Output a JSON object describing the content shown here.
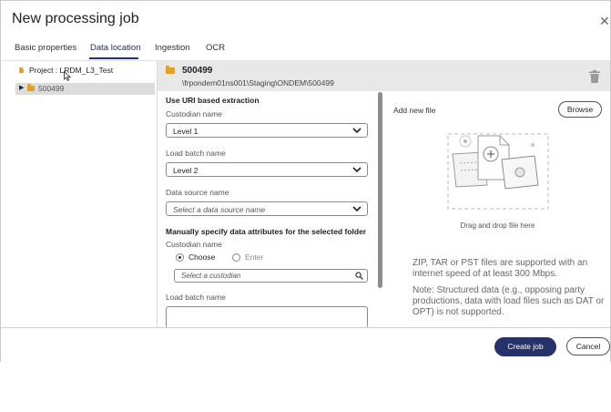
{
  "dialog": {
    "title": "New processing job"
  },
  "tabs": [
    "Basic properties",
    "Data location",
    "Ingestion",
    "OCR"
  ],
  "active_tab": "Data location",
  "tree": {
    "project_label": "Project : LRDM_L3_Test",
    "items": [
      {
        "label": "500499",
        "selected": true
      }
    ]
  },
  "folder": {
    "name": "500499",
    "path": "\\frpondem01ns001\\Staging\\ONDEM\\500499"
  },
  "form": {
    "uri_heading": "Use URI based extraction",
    "custodian_label": "Custodian name",
    "custodian_value": "Level 1",
    "load_batch_label": "Load batch name",
    "load_batch_value": "Level 2",
    "data_source_label": "Data source name",
    "data_source_placeholder": "Select a data source name",
    "manual_heading": "Manually specify data attributes for the selected folder",
    "manual_custodian_label": "Custodian name",
    "radio_choose": "Choose",
    "radio_enter": "Enter",
    "radio_selected": "Choose",
    "custodian_search_placeholder": "Select a custodian",
    "manual_load_batch_label": "Load batch name"
  },
  "upload": {
    "add_new_file": "Add new file",
    "browse_label": "Browse",
    "drag_drop": "Drag and drop file here",
    "info_1": "ZIP, TAR or PST files are supported with an internet speed of at least 300 Mbps.",
    "info_2": "Note: Structured data (e.g., opposing party productions, data with load files such as DAT or OPT) is not supported."
  },
  "footer": {
    "create_label": "Create job",
    "cancel_label": "Cancel"
  },
  "colors": {
    "primary": "#26336a",
    "folder": "#e6a020"
  }
}
